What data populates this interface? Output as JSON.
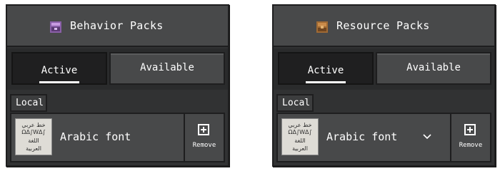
{
  "panels": [
    {
      "title": "Behavior Packs",
      "title_icon": "behavior-pack-icon",
      "tabs": {
        "active": "Active",
        "available": "Available"
      },
      "section": "Local",
      "pack": {
        "name": "Arabic font",
        "thumbnail_text": [
          "خط عربي",
          "ΩΔ∫WΔ∫",
          "اللغة",
          "العربية"
        ],
        "expand_icon": "chevron-down-icon",
        "remove_label": "Remove",
        "remove_icon": "remove-icon"
      }
    },
    {
      "title": "Resource Packs",
      "title_icon": "resource-pack-icon",
      "tabs": {
        "active": "Active",
        "available": "Available"
      },
      "section": "Local",
      "pack": {
        "name": "Arabic font",
        "thumbnail_text": [
          "خط عربي",
          "ΩΔ∫WΔ∫",
          "اللغة",
          "العربية"
        ],
        "expand_icon": "chevron-down-icon",
        "remove_label": "Remove",
        "remove_icon": "remove-icon"
      }
    }
  ],
  "colors": {
    "panel": "#313233",
    "header": "#48494a",
    "border": "#1e1e1f",
    "behavior_icon": "#8a5fa8",
    "resource_icon": "#a06a34",
    "text": "#ffffff"
  }
}
